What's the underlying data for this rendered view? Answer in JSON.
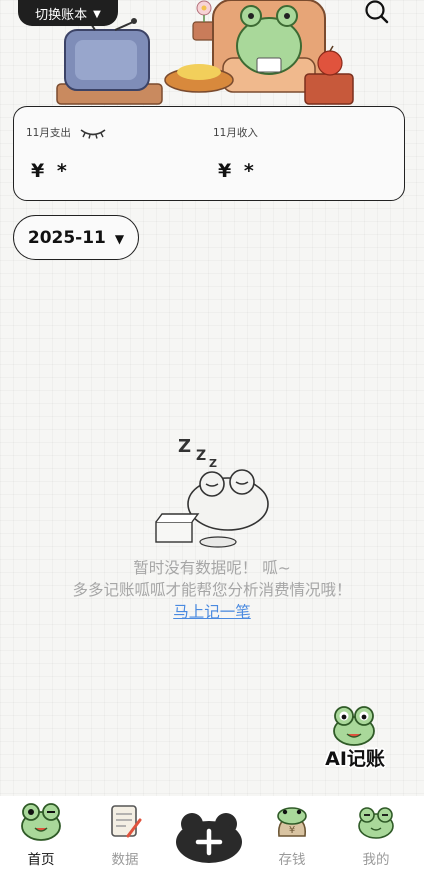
{
  "header": {
    "switch_book_label": "切换账本",
    "dropdown_glyph": "▼",
    "search_icon": "search-icon",
    "scene_icon": "frog-living-room-illustration"
  },
  "summary": {
    "expense_label": "11月支出",
    "expense_value": "¥ *",
    "income_label": "11月收入",
    "income_value": "¥ *",
    "visibility_icon": "closed-eye-icon"
  },
  "month": {
    "value": "2025-11",
    "dropdown_glyph": "▼"
  },
  "empty_state": {
    "icon": "sleeping-frog-icon",
    "line1": "暂时没有数据呢！ 呱~",
    "line2": "多多记账呱呱才能帮您分析消费情况哦！",
    "link": "马上记一笔"
  },
  "ai_button": {
    "label": "AI记账",
    "icon": "frog-icon"
  },
  "tabbar": {
    "tabs": [
      {
        "label": "首页",
        "icon": "frog-home-icon",
        "active": true
      },
      {
        "label": "数据",
        "icon": "notebook-icon",
        "active": false
      },
      {
        "label": "存钱",
        "icon": "frog-money-bag-icon",
        "active": false
      },
      {
        "label": "我的",
        "icon": "frog-face-icon",
        "active": false
      }
    ],
    "add_icon": "plus-icon"
  },
  "colors": {
    "ink": "#1f1f1f",
    "frog_green": "#a9d89a",
    "link_blue": "#4a8ae0",
    "muted_text": "#a6a6a6",
    "accent_red": "#e0533d"
  }
}
